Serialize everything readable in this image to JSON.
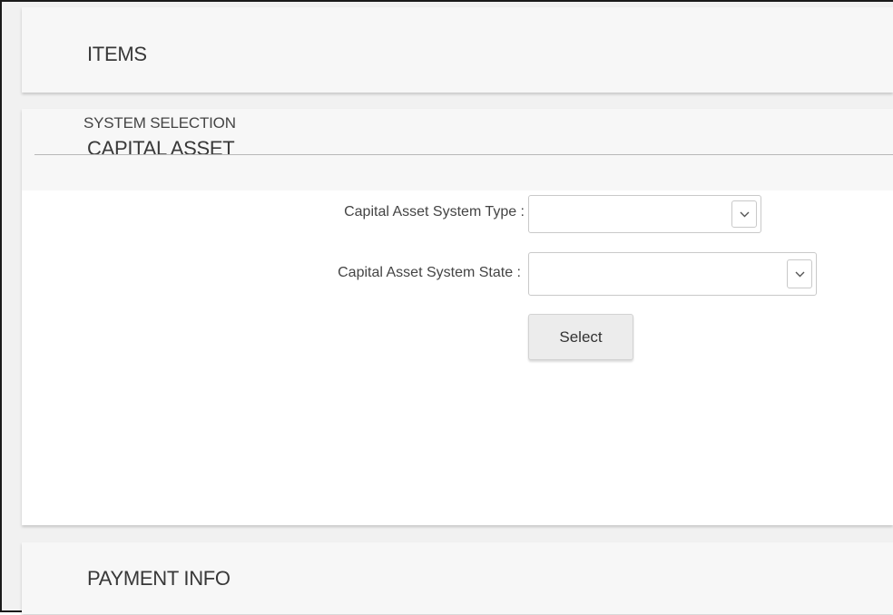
{
  "sections": {
    "items": {
      "title": "ITEMS"
    },
    "capital_asset": {
      "title": "CAPITAL ASSET",
      "system_selection": {
        "title": "SYSTEM SELECTION",
        "system_type": {
          "label": "Capital Asset System Type :",
          "value": ""
        },
        "system_state": {
          "label": "Capital Asset System State :",
          "value": ""
        },
        "select_button_label": "Select"
      }
    },
    "payment_info": {
      "title": "PAYMENT INFO"
    }
  },
  "icons": {
    "dropdown": "chevron-down-icon"
  }
}
